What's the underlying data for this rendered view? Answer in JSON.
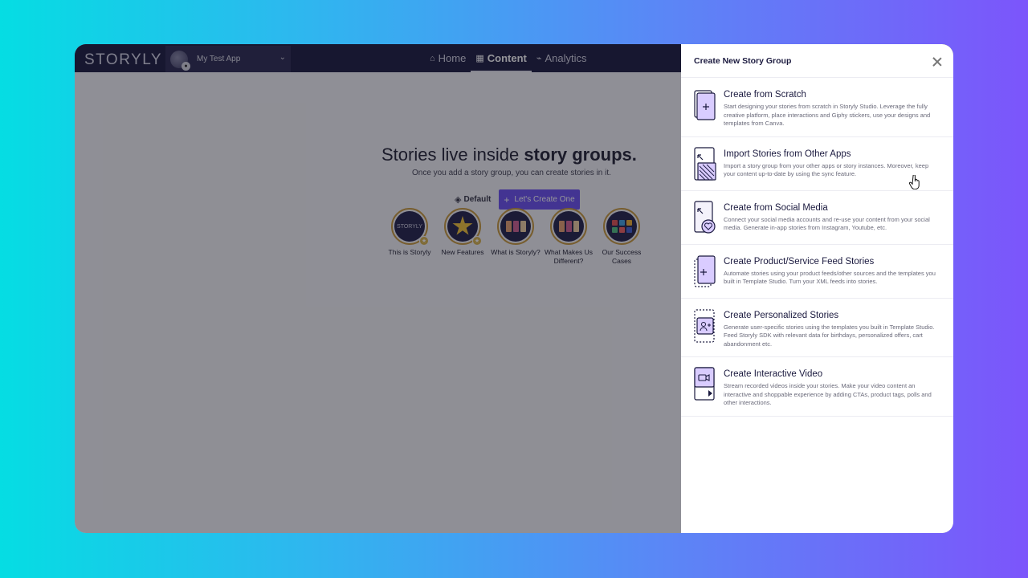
{
  "nav": {
    "logo": "STORYLY",
    "app_name": "My Test App",
    "links": [
      {
        "label": "Home",
        "icon": "home-icon"
      },
      {
        "label": "Content",
        "icon": "grid-icon",
        "active": true
      },
      {
        "label": "Analytics",
        "icon": "activity-icon"
      }
    ]
  },
  "empty_state": {
    "headline_regular": "Stories live inside ",
    "headline_bold": "story groups.",
    "subline": "Once you add a story group, you can create stories in it.",
    "default_label": "Default",
    "create_button": "Let's Create One"
  },
  "stories": [
    {
      "label": "This is Storyly",
      "cover_text": "STORYLY"
    },
    {
      "label": "New Features",
      "cover_text": ""
    },
    {
      "label": "What is Storyly?",
      "cover_text": ""
    },
    {
      "label": "What Makes Us Different?",
      "cover_text": ""
    },
    {
      "label": "Our Success Cases",
      "cover_text": ""
    }
  ],
  "drawer": {
    "title": "Create New Story Group",
    "options": [
      {
        "title": "Create from Scratch",
        "description": "Start designing your stories from scratch in Storyly Studio. Leverage the fully creative platform, place interactions and Giphy stickers, use your designs and templates from Canva.",
        "icon": "plus-page-icon"
      },
      {
        "title": "Import Stories from Other Apps",
        "description": "Import a story group from your other apps or story instances. Moreover, keep your content up-to-date by using the sync feature.",
        "icon": "import-icon"
      },
      {
        "title": "Create from Social Media",
        "description": "Connect your social media accounts and re-use your content from your social media. Generate in-app stories from Instagram, Youtube, etc.",
        "icon": "heart-page-icon"
      },
      {
        "title": "Create Product/Service Feed Stories",
        "description": "Automate stories using your product feeds/other sources and the templates you built in Template Studio. Turn your XML feeds into stories.",
        "icon": "feed-page-icon"
      },
      {
        "title": "Create Personalized Stories",
        "description": "Generate user-specific stories using the templates you built in Template Studio. Feed Storyly SDK with relevant data for birthdays, personalized offers, cart abandonment etc.",
        "icon": "user-plus-page-icon"
      },
      {
        "title": "Create Interactive Video",
        "description": "Stream recorded videos inside your stories. Make your video content an interactive and shoppable experience by adding CTAs, product tags, polls and other interactions.",
        "icon": "video-page-icon"
      }
    ]
  },
  "colors": {
    "nav_bg": "#1b1a3f",
    "accent": "#6b4ff0",
    "story_ring": "#c99a3b"
  }
}
